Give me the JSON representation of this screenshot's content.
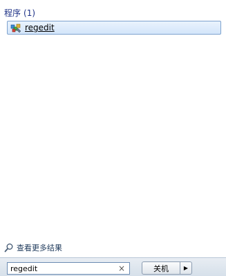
{
  "results": {
    "group_title": "程序",
    "group_count": "(1)",
    "items": [
      {
        "label": "regedit",
        "icon": "regedit-icon"
      }
    ]
  },
  "see_more": {
    "label": "查看更多结果",
    "icon": "search-icon"
  },
  "search": {
    "value": "regedit",
    "clear_symbol": "×"
  },
  "shutdown": {
    "label": "关机",
    "arrow_symbol": "▶"
  },
  "colors": {
    "accent": "#1e3287",
    "highlight_border": "#7da2ce",
    "highlight_fill": "#d3e5fa",
    "panel_bar": "#dfe6ee"
  }
}
